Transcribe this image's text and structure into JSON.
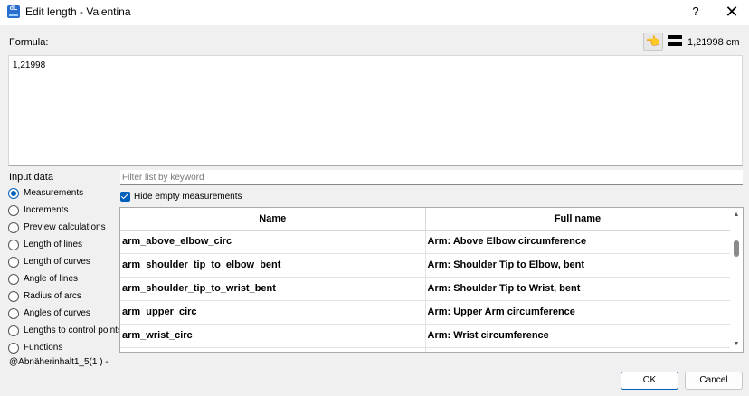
{
  "window": {
    "title": "Edit length - Valentina",
    "app_icon_text": "dL",
    "help_label": "?",
    "close_label": "✕"
  },
  "formula": {
    "label": "Formula:",
    "value": "1,21998",
    "result": "1,21998 cm"
  },
  "input_data": {
    "label": "Input data",
    "options": [
      {
        "label": "Measurements",
        "checked": true
      },
      {
        "label": "Increments",
        "checked": false
      },
      {
        "label": "Preview calculations",
        "checked": false
      },
      {
        "label": "Length of lines",
        "checked": false
      },
      {
        "label": "Length of curves",
        "checked": false
      },
      {
        "label": "Angle of lines",
        "checked": false
      },
      {
        "label": "Radius of arcs",
        "checked": false
      },
      {
        "label": "Angles of curves",
        "checked": false
      },
      {
        "label": "Lengths to control points",
        "checked": false
      },
      {
        "label": "Functions",
        "checked": false
      }
    ]
  },
  "filter": {
    "placeholder": "Filter list by keyword",
    "value": ""
  },
  "hide_empty": {
    "label": "Hide empty measurements",
    "checked": true
  },
  "table": {
    "columns": [
      "Name",
      "Full name"
    ],
    "rows": [
      [
        "arm_above_elbow_circ",
        "Arm: Above Elbow circumference"
      ],
      [
        "arm_shoulder_tip_to_elbow_bent",
        "Arm: Shoulder Tip to Elbow, bent"
      ],
      [
        "arm_shoulder_tip_to_wrist_bent",
        "Arm: Shoulder Tip to Wrist, bent"
      ],
      [
        "arm_upper_circ",
        "Arm: Upper Arm circumference"
      ],
      [
        "arm_wrist_circ",
        "Arm: Wrist circumference"
      ]
    ]
  },
  "status": "@Abnäherinhalt1_5(1 ) -",
  "buttons": {
    "ok": "OK",
    "cancel": "Cancel"
  },
  "colors": {
    "accent": "#005fb8"
  }
}
